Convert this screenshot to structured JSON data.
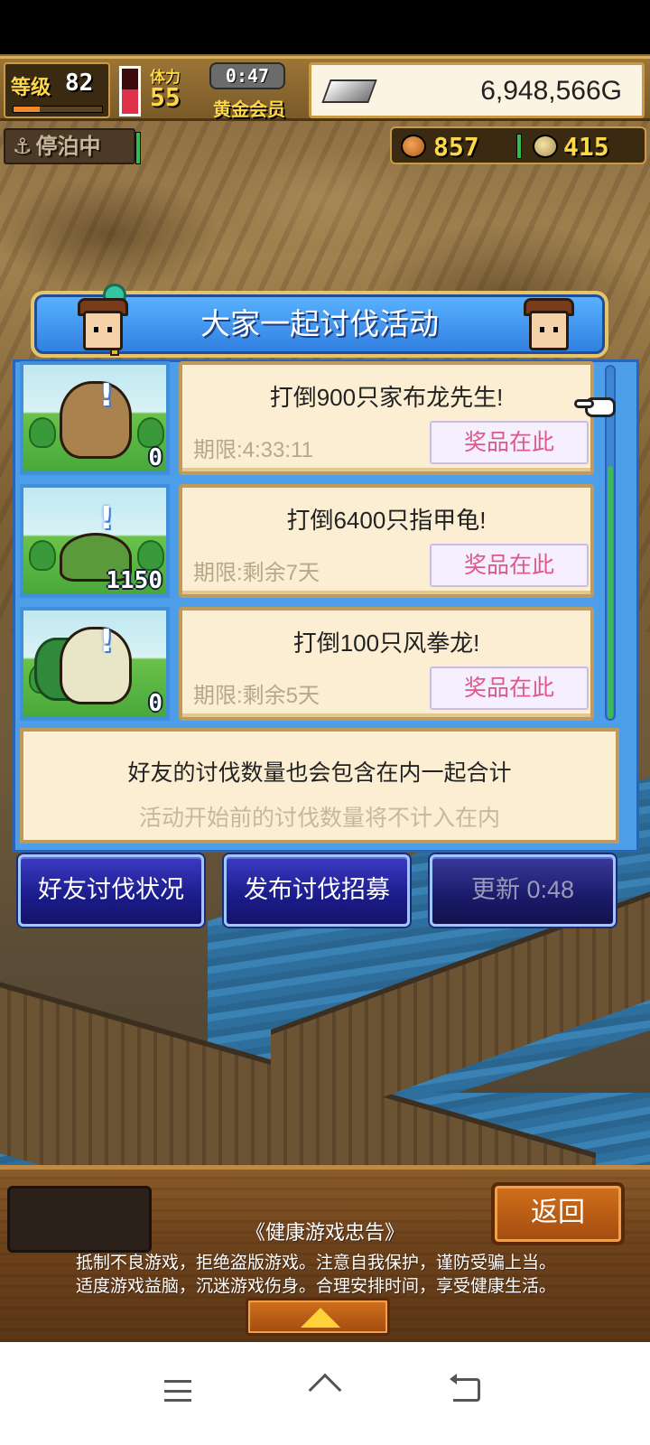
{
  "hud": {
    "level_label": "等级",
    "level_value": "82",
    "level_progress": 0.3,
    "stamina_label": "体力",
    "stamina_value": "55",
    "stamina_level": 0.55,
    "timer": "0:47",
    "member_label": "黄金会员",
    "gold": "6,948,566G",
    "silver_icon": "silver-ingot-icon",
    "docked_label": "停泊中",
    "docked_icon": "anchor-icon",
    "ball_count": "857",
    "ball_icon": "ball-icon",
    "coin_count": "415",
    "coin_icon": "coin-icon"
  },
  "dialog": {
    "title": "大家一起讨伐活动",
    "quests": [
      {
        "title": "打倒900只家布龙先生!",
        "deadline": "期限:4:33:11",
        "count": "0",
        "reward_label": "奖品在此"
      },
      {
        "title": "打倒6400只指甲龟!",
        "deadline": "期限:剩余7天",
        "count": "1150",
        "reward_label": "奖品在此"
      },
      {
        "title": "打倒100只风拳龙!",
        "deadline": "期限:剩余5天",
        "count": "0",
        "reward_label": "奖品在此"
      }
    ],
    "info_line1": "好友的讨伐数量也会包含在内一起合计",
    "info_line2": "活动开始前的讨伐数量将不计入在内",
    "buttons": {
      "friends": "好友讨伐状况",
      "recruit": "发布讨伐招募",
      "refresh": "更新 0:48"
    }
  },
  "bottom": {
    "back_label": "返回",
    "advice_title": "《健康游戏忠告》",
    "advice_line1": "抵制不良游戏，拒绝盗版游戏。注意自我保护，谨防受骗上当。",
    "advice_line2": "适度游戏益脑，沉迷游戏伤身。合理安排时间，享受健康生活。"
  },
  "colors": {
    "dialog_blue": "#4d9ee8",
    "card_bg": "#fbeed2",
    "reward_text": "#e0588a",
    "button_blue": "#1b1b8a",
    "hud_gold": "#ffd84a"
  }
}
